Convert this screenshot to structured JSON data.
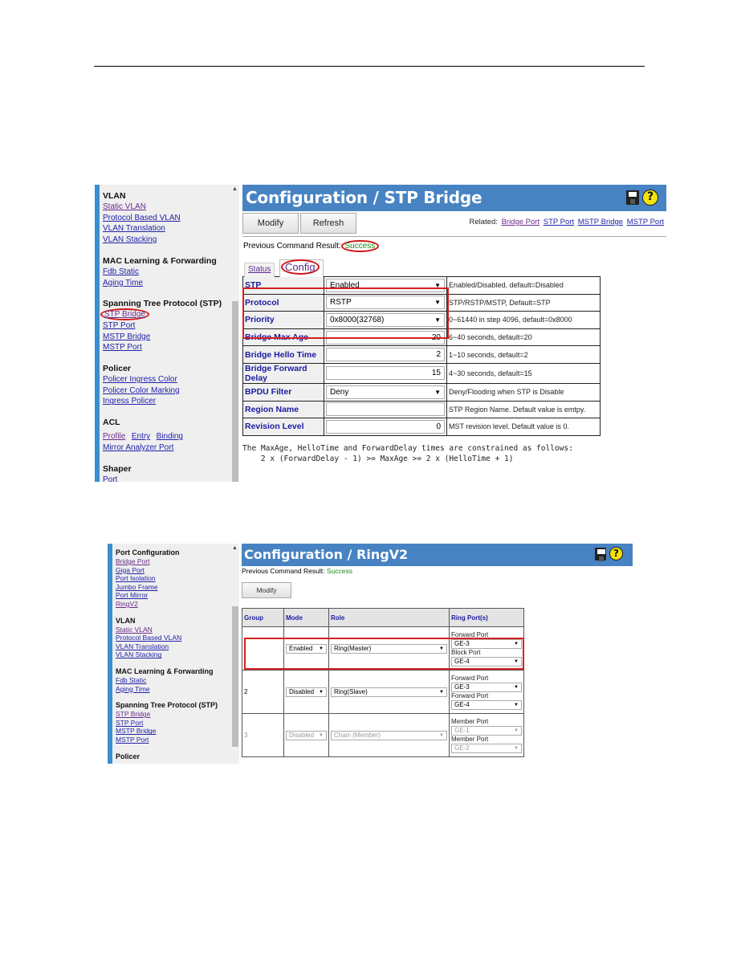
{
  "screenshot1": {
    "sidebar": {
      "groups": [
        {
          "heading": "VLAN",
          "links": [
            "Static VLAN",
            "Protocol Based VLAN",
            "VLAN Translation",
            "VLAN Stacking"
          ]
        },
        {
          "heading": "MAC Learning & Forwarding",
          "links": [
            "Fdb Static",
            "Aging Time"
          ]
        },
        {
          "heading": "Spanning Tree Protocol (STP)",
          "links": [
            "STP Bridge",
            "STP Port",
            "MSTP Bridge",
            "MSTP Port"
          ]
        },
        {
          "heading": "Policer",
          "links": [
            "Policer Ingress Color",
            "Policer Color Marking",
            "Ingress Policer"
          ]
        },
        {
          "heading": "ACL",
          "links": [
            "Profile",
            "Entry",
            "Binding",
            "Mirror Analyzer Port"
          ]
        },
        {
          "heading": "Shaper",
          "links": [
            "Port"
          ]
        }
      ]
    },
    "title": "Configuration / STP Bridge",
    "icons": {
      "save": "save-icon",
      "help": "help-icon"
    },
    "help_glyph": "?",
    "buttons": {
      "modify": "Modify",
      "refresh": "Refresh"
    },
    "related": {
      "label": "Related:",
      "links": [
        "Bridge Port",
        "STP Port",
        "MSTP Bridge",
        "MSTP Port"
      ]
    },
    "result": {
      "label": "Previous Command Result:",
      "value": "Success"
    },
    "tabs": {
      "status": "Status",
      "config": "Config"
    },
    "rows": [
      {
        "label": "STP",
        "type": "select",
        "value": "Enabled",
        "desc": "Enabled/Disabled, default=Disabled"
      },
      {
        "label": "Protocol",
        "type": "select",
        "value": "RSTP",
        "desc": "STP/RSTP/MSTP, Default=STP"
      },
      {
        "label": "Priority",
        "type": "select",
        "value": "0x8000(32768)",
        "desc": "0~61440 in step 4096, default=0x8000"
      },
      {
        "label": "Bridge Max Age",
        "type": "input",
        "value": "20",
        "desc": "6~40 seconds, default=20"
      },
      {
        "label": "Bridge Hello Time",
        "type": "input",
        "value": "2",
        "desc": "1~10 seconds, default=2"
      },
      {
        "label": "Bridge Forward Delay",
        "type": "input",
        "value": "15",
        "desc": "4~30 seconds, default=15"
      },
      {
        "label": "BPDU Filter",
        "type": "select",
        "value": "Deny",
        "desc": "Deny/Flooding when STP is Disable"
      },
      {
        "label": "Region Name",
        "type": "input",
        "value": "",
        "desc": "STP Region Name. Default value is emtpy."
      },
      {
        "label": "Revision Level",
        "type": "input",
        "value": "0",
        "desc": "MST revision level. Default value is 0."
      }
    ],
    "constraint_line1": "The MaxAge, HelloTime and ForwardDelay times are constrained as follows:",
    "constraint_line2": "    2 x (ForwardDelay - 1) >= MaxAge >= 2 x (HelloTime + 1)"
  },
  "screenshot2": {
    "sidebar": {
      "groups": [
        {
          "heading": "Port Configuration",
          "links": [
            "Bridge Port",
            "Giga Port",
            "Port Isolation",
            "Jumbo Frame",
            "Port Mirror",
            "RingV2"
          ]
        },
        {
          "heading": "VLAN",
          "links": [
            "Static VLAN",
            "Protocol Based VLAN",
            "VLAN Translation",
            "VLAN Stacking"
          ]
        },
        {
          "heading": "MAC Learning & Forwarding",
          "links": [
            "Fdb Static",
            "Aging Time"
          ]
        },
        {
          "heading": "Spanning Tree Protocol (STP)",
          "links": [
            "STP Bridge",
            "STP Port",
            "MSTP Bridge",
            "MSTP Port"
          ]
        },
        {
          "heading": "Policer",
          "links": []
        }
      ]
    },
    "title": "Configuration / RingV2",
    "help_glyph": "?",
    "result": {
      "label": "Previous Command Result:",
      "value": "Success"
    },
    "buttons": {
      "modify": "Modify"
    },
    "table": {
      "headers": [
        "Group",
        "Mode",
        "Role",
        "Ring Port(s)"
      ],
      "rows": [
        {
          "group": "",
          "mode": "Enabled",
          "role": "Ring(Master)",
          "disabled": false,
          "ports": [
            {
              "label": "Forward Port",
              "value": "GE-3"
            },
            {
              "label": "Block Port",
              "value": "GE-4"
            }
          ]
        },
        {
          "group": "2",
          "mode": "Disabled",
          "role": "Ring(Slave)",
          "disabled": false,
          "ports": [
            {
              "label": "Forward Port",
              "value": "GE-3"
            },
            {
              "label": "Forward Port",
              "value": "GE-4"
            }
          ]
        },
        {
          "group": "3",
          "mode": "Disabled",
          "role": "Chain (Member)",
          "disabled": true,
          "ports": [
            {
              "label": "Member Port",
              "value": "GE-1"
            },
            {
              "label": "Member Port",
              "value": "GE-2"
            }
          ]
        }
      ]
    }
  },
  "colors": {
    "title_bar": "#4783c2",
    "sidebar_accent": "#3a8fd0",
    "success": "#1a8a1a",
    "highlight": "#d42020",
    "label_blue": "#1a1aa0"
  }
}
